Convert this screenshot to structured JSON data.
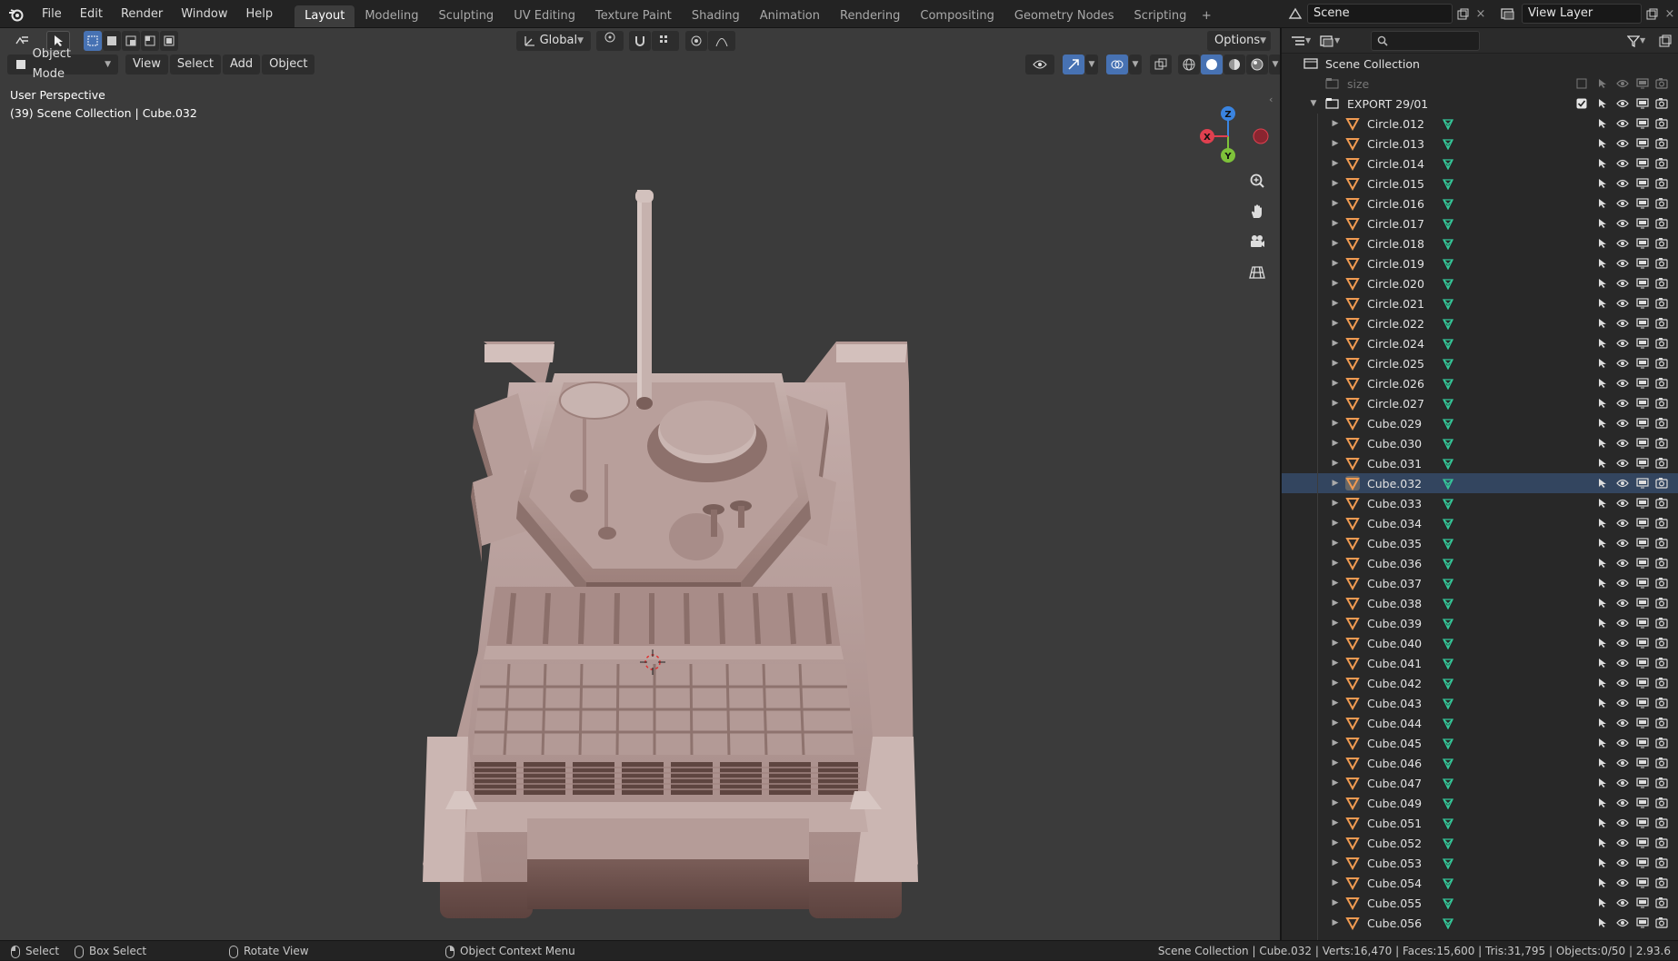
{
  "topbar": {
    "menus": [
      "File",
      "Edit",
      "Render",
      "Window",
      "Help"
    ],
    "workspaces": [
      "Layout",
      "Modeling",
      "Sculpting",
      "UV Editing",
      "Texture Paint",
      "Shading",
      "Animation",
      "Rendering",
      "Compositing",
      "Geometry Nodes",
      "Scripting"
    ],
    "active_workspace": "Layout",
    "scene": "Scene",
    "view_layer": "View Layer"
  },
  "viewport": {
    "transform_orientation": "Global",
    "options_label": "Options",
    "mode": "Object Mode",
    "menus": [
      "View",
      "Select",
      "Add",
      "Object"
    ],
    "perspective_label": "User Perspective",
    "context_label": "(39) Scene Collection | Cube.032",
    "gizmo_axes": {
      "x": "X",
      "y": "Y",
      "z": "Z"
    },
    "colors": {
      "background": "#3b3b3b",
      "model": "#b39a95",
      "x_axis": "#e0404f",
      "y_axis": "#7ec23a",
      "z_axis": "#3a84e0"
    }
  },
  "outliner": {
    "search_placeholder": "",
    "root": "Scene Collection",
    "items": [
      {
        "name": "size",
        "kind": "collection-excluded"
      },
      {
        "name": "EXPORT 29/01",
        "kind": "collection"
      },
      {
        "name": "Circle.012",
        "kind": "mesh"
      },
      {
        "name": "Circle.013",
        "kind": "mesh"
      },
      {
        "name": "Circle.014",
        "kind": "mesh"
      },
      {
        "name": "Circle.015",
        "kind": "mesh"
      },
      {
        "name": "Circle.016",
        "kind": "mesh"
      },
      {
        "name": "Circle.017",
        "kind": "mesh"
      },
      {
        "name": "Circle.018",
        "kind": "mesh"
      },
      {
        "name": "Circle.019",
        "kind": "mesh"
      },
      {
        "name": "Circle.020",
        "kind": "mesh"
      },
      {
        "name": "Circle.021",
        "kind": "mesh"
      },
      {
        "name": "Circle.022",
        "kind": "mesh"
      },
      {
        "name": "Circle.024",
        "kind": "mesh"
      },
      {
        "name": "Circle.025",
        "kind": "mesh"
      },
      {
        "name": "Circle.026",
        "kind": "mesh"
      },
      {
        "name": "Circle.027",
        "kind": "mesh"
      },
      {
        "name": "Cube.029",
        "kind": "mesh"
      },
      {
        "name": "Cube.030",
        "kind": "mesh"
      },
      {
        "name": "Cube.031",
        "kind": "mesh"
      },
      {
        "name": "Cube.032",
        "kind": "mesh",
        "selected": true
      },
      {
        "name": "Cube.033",
        "kind": "mesh"
      },
      {
        "name": "Cube.034",
        "kind": "mesh"
      },
      {
        "name": "Cube.035",
        "kind": "mesh"
      },
      {
        "name": "Cube.036",
        "kind": "mesh"
      },
      {
        "name": "Cube.037",
        "kind": "mesh"
      },
      {
        "name": "Cube.038",
        "kind": "mesh"
      },
      {
        "name": "Cube.039",
        "kind": "mesh"
      },
      {
        "name": "Cube.040",
        "kind": "mesh"
      },
      {
        "name": "Cube.041",
        "kind": "mesh"
      },
      {
        "name": "Cube.042",
        "kind": "mesh"
      },
      {
        "name": "Cube.043",
        "kind": "mesh"
      },
      {
        "name": "Cube.044",
        "kind": "mesh"
      },
      {
        "name": "Cube.045",
        "kind": "mesh"
      },
      {
        "name": "Cube.046",
        "kind": "mesh"
      },
      {
        "name": "Cube.047",
        "kind": "mesh"
      },
      {
        "name": "Cube.049",
        "kind": "mesh"
      },
      {
        "name": "Cube.051",
        "kind": "mesh"
      },
      {
        "name": "Cube.052",
        "kind": "mesh"
      },
      {
        "name": "Cube.053",
        "kind": "mesh"
      },
      {
        "name": "Cube.054",
        "kind": "mesh"
      },
      {
        "name": "Cube.055",
        "kind": "mesh"
      },
      {
        "name": "Cube.056",
        "kind": "mesh"
      }
    ]
  },
  "statusbar": {
    "select": "Select",
    "box_select": "Box Select",
    "rotate_view": "Rotate View",
    "context_menu": "Object Context Menu",
    "stats": "Scene Collection | Cube.032 | Verts:16,470 | Faces:15,600 | Tris:31,795 | Objects:0/50 | 2.93.6"
  }
}
